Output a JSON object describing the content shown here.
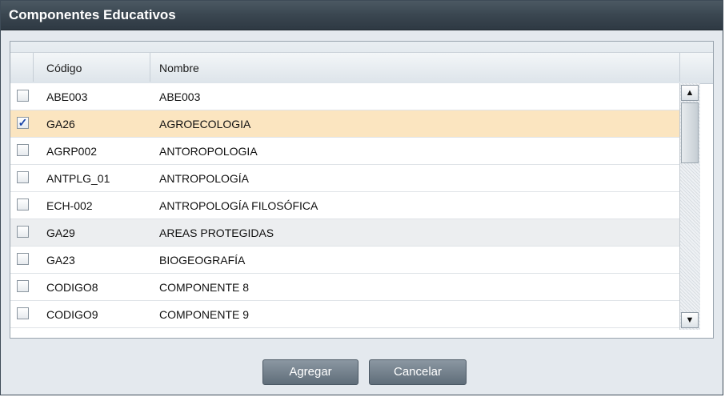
{
  "dialog": {
    "title": "Componentes Educativos",
    "columns": {
      "code": "Código",
      "name": "Nombre"
    },
    "rows": [
      {
        "checked": false,
        "code": "ABE003",
        "name": "ABE003"
      },
      {
        "checked": true,
        "code": "GA26",
        "name": "AGROECOLOGIA"
      },
      {
        "checked": false,
        "code": "AGRP002",
        "name": "ANTOROPOLOGIA"
      },
      {
        "checked": false,
        "code": "ANTPLG_01",
        "name": "ANTROPOLOGÍA"
      },
      {
        "checked": false,
        "code": "ECH-002",
        "name": "ANTROPOLOGÍA FILOSÓFICA"
      },
      {
        "checked": false,
        "code": "GA29",
        "name": "AREAS PROTEGIDAS"
      },
      {
        "checked": false,
        "code": "GA23",
        "name": "BIOGEOGRAFÍA"
      },
      {
        "checked": false,
        "code": "CODIGO8",
        "name": "COMPONENTE 8"
      },
      {
        "checked": false,
        "code": "CODIGO9",
        "name": "COMPONENTE 9"
      }
    ],
    "buttons": {
      "add": "Agregar",
      "cancel": "Cancelar"
    },
    "icons": {
      "scroll_up": "up-arrow-icon",
      "scroll_down": "down-arrow-icon",
      "check": "checkmark-icon"
    },
    "colors": {
      "title_bar": "#3a4650",
      "selected_row": "#fbe5c0",
      "button": "#6f7c88"
    }
  }
}
